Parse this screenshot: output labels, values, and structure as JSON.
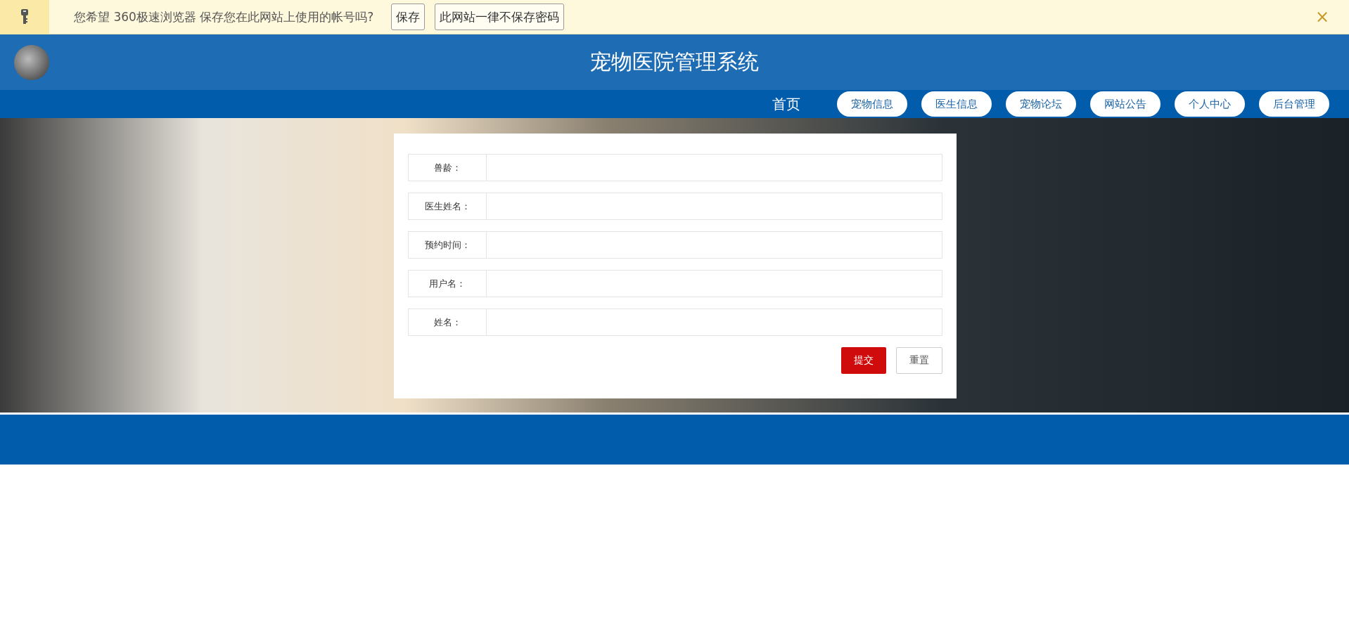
{
  "password_bar": {
    "message": "您希望 360极速浏览器 保存您在此网站上使用的帐号吗?",
    "buttons": [
      "保存",
      "此网站一律不保存密码"
    ],
    "close": "×"
  },
  "header": {
    "title": "宠物医院管理系统"
  },
  "nav": [
    {
      "label": "首页",
      "kind": "text"
    },
    {
      "label": "宠物信息",
      "kind": "pill"
    },
    {
      "label": "医生信息",
      "kind": "pill"
    },
    {
      "label": "宠物论坛",
      "kind": "pill"
    },
    {
      "label": "网站公告",
      "kind": "pill"
    },
    {
      "label": "个人中心",
      "kind": "pill"
    },
    {
      "label": "后台管理",
      "kind": "pill"
    }
  ],
  "form": {
    "fields": [
      {
        "label": "兽龄："
      },
      {
        "label": "医生姓名："
      },
      {
        "label": "预约时间："
      },
      {
        "label": "用户名："
      },
      {
        "label": "姓名："
      }
    ],
    "buttons": [
      {
        "label": "提交",
        "kind": "primary"
      },
      {
        "label": "重置",
        "kind": "secondary"
      }
    ]
  }
}
